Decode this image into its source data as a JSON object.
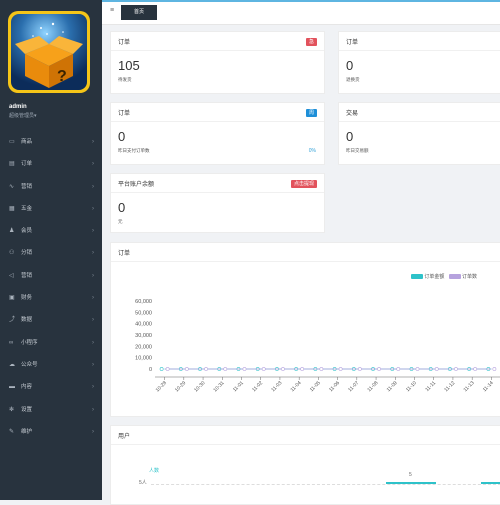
{
  "sidebar": {
    "user": {
      "name": "admin",
      "role": "超级管理员"
    },
    "role_caret": "▾",
    "items": [
      {
        "label": "商品",
        "icon": "monitor-icon",
        "glyph": "▭"
      },
      {
        "label": "订单",
        "icon": "order-icon",
        "glyph": "▤"
      },
      {
        "label": "营销",
        "icon": "chart-line-icon",
        "glyph": "∿"
      },
      {
        "label": "五金",
        "icon": "grid-icon",
        "glyph": "▦"
      },
      {
        "label": "会员",
        "icon": "user-icon",
        "glyph": "♟"
      },
      {
        "label": "分销",
        "icon": "distribution-icon",
        "glyph": "⚇"
      },
      {
        "label": "营销",
        "icon": "megaphone-icon",
        "glyph": "◁"
      },
      {
        "label": "财务",
        "icon": "money-icon",
        "glyph": "▣"
      },
      {
        "label": "数据",
        "icon": "stats-icon",
        "glyph": "⤴"
      },
      {
        "label": "小程序",
        "icon": "link-icon",
        "glyph": "∞"
      },
      {
        "label": "公众号",
        "icon": "wechat-icon",
        "glyph": "☁"
      },
      {
        "label": "内容",
        "icon": "content-icon",
        "glyph": "▬"
      },
      {
        "label": "设置",
        "icon": "gear-icon",
        "glyph": "✻"
      },
      {
        "label": "维护",
        "icon": "wrench-icon",
        "glyph": "✎"
      }
    ],
    "arrow": "›"
  },
  "topbar": {
    "menu_glyph": "≡",
    "home_tab": "首页"
  },
  "cards": {
    "order1": {
      "title": "订单",
      "badge": "急",
      "badge_color": "#e2525c",
      "value": "105",
      "sub": "待发货"
    },
    "order2": {
      "title": "订单",
      "value": "0",
      "sub": "退换货"
    },
    "order3": {
      "title": "订单",
      "badge": "周",
      "badge_color": "#1e8fd8",
      "value": "0",
      "sub": "昨日支付订单数",
      "pct": "0%"
    },
    "trade": {
      "title": "交易",
      "value": "0",
      "sub": "昨日交易额"
    },
    "balance": {
      "title": "平台账户余额",
      "badge": "点击提现",
      "badge_color": "#e2525c",
      "value": "0",
      "sub": "元"
    }
  },
  "orders_panel": {
    "title": "订单"
  },
  "users_panel": {
    "title": "用户"
  },
  "chart_data": [
    {
      "type": "line",
      "title": "订单",
      "categories": [
        "10-28",
        "10-29",
        "10-30",
        "10-31",
        "11-01",
        "11-02",
        "11-03",
        "11-04",
        "11-05",
        "11-06",
        "11-07",
        "11-08",
        "11-09",
        "11-10",
        "11-11",
        "11-12",
        "11-13",
        "11-14"
      ],
      "series": [
        {
          "name": "订单金额",
          "color": "#2ec2c9",
          "values": [
            0,
            0,
            0,
            0,
            0,
            0,
            0,
            0,
            0,
            0,
            0,
            0,
            0,
            0,
            0,
            0,
            0,
            0
          ]
        },
        {
          "name": "订单数",
          "color": "#b6a2de",
          "values": [
            0,
            0,
            0,
            0,
            0,
            0,
            0,
            0,
            0,
            0,
            0,
            0,
            0,
            0,
            0,
            0,
            0,
            0
          ]
        }
      ],
      "y_ticks": [
        "0",
        "10,000",
        "20,000",
        "30,000",
        "40,000",
        "50,000",
        "60,000"
      ],
      "ylim": [
        0,
        60000
      ],
      "grid": false,
      "legend": "top-right"
    },
    {
      "type": "bar",
      "title": "用户",
      "ylabel": "人数",
      "y_ticks": [
        "5人"
      ],
      "data_labels": [
        "5"
      ]
    }
  ]
}
